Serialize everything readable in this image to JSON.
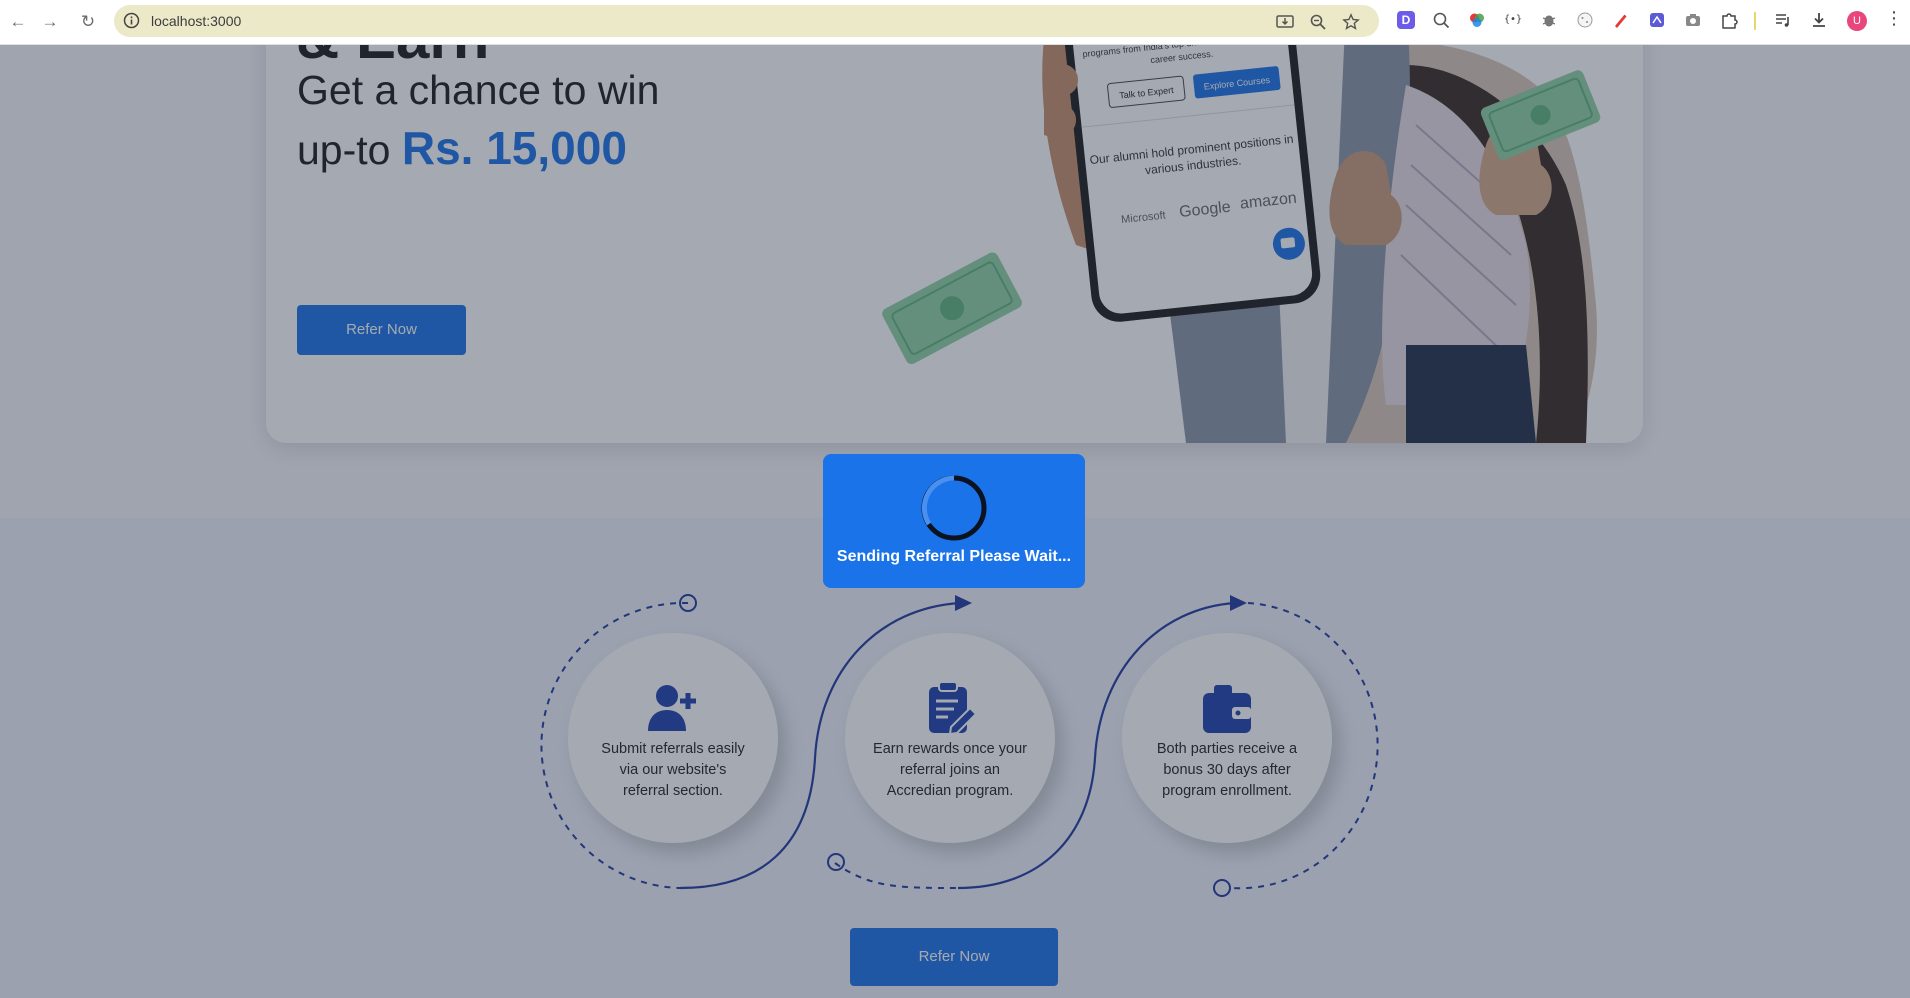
{
  "browser": {
    "url": "localhost:3000",
    "avatar_initial": "U",
    "extensions": [
      "D",
      "search-lens",
      "color-wheel",
      "{•}",
      "bug",
      "cookie",
      "pen",
      "box",
      "camera",
      "puzzle"
    ]
  },
  "hero": {
    "partial_heading": "& Earn",
    "line1": "Get a chance to win",
    "line2_prefix": "up-to ",
    "amount": "Rs. 15,000",
    "cta_label": "Refer Now",
    "phone": {
      "welcome_text": "Welcome to Accredian, your gateway to premier online programs from India's top universities, tailored for career success.",
      "talk_btn": "Talk to Expert",
      "explore_btn": "Explore Courses",
      "alumni_text": "Our alumni hold prominent positions in various industries.",
      "logos": [
        "Microsoft",
        "Google",
        "amazon"
      ]
    }
  },
  "steps": [
    {
      "icon": "add-user-icon",
      "text": "Submit referrals easily via our website's referral section."
    },
    {
      "icon": "clipboard-pen-icon",
      "text": "Earn rewards once your referral joins an Accredian program."
    },
    {
      "icon": "wallet-icon",
      "text": "Both parties receive a bonus 30 days after program enrollment."
    }
  ],
  "steps_cta_label": "Refer Now",
  "modal": {
    "message": "Sending Referral Please Wait..."
  },
  "colors": {
    "primary": "#1a73e8",
    "dark_blue": "#1e40af",
    "overlay": "rgba(40,50,70,0.42)"
  }
}
